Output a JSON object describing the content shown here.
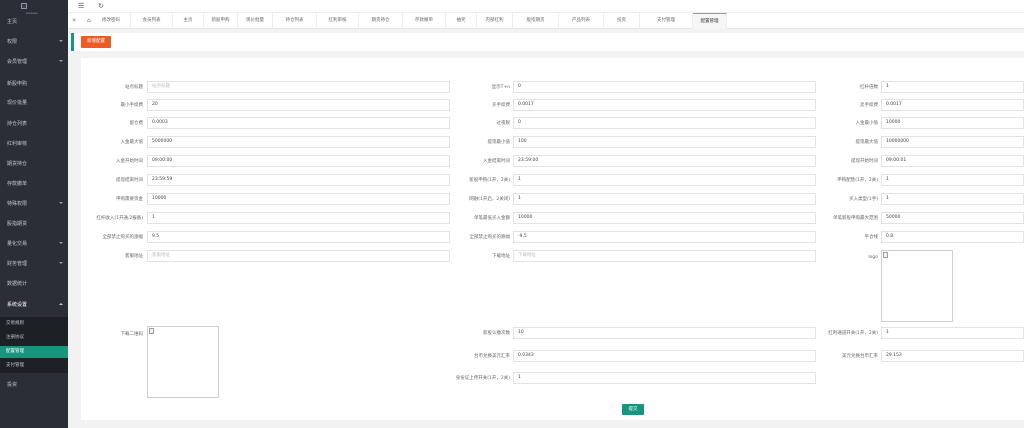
{
  "logo": {
    "sub": "Release"
  },
  "sidebar": {
    "items": [
      {
        "label": "主页",
        "arrow": "none"
      },
      {
        "label": "权限",
        "arrow": "down"
      },
      {
        "label": "会员管理",
        "arrow": "down"
      },
      {
        "label": "新股申购",
        "arrow": "none"
      },
      {
        "label": "现价批量",
        "arrow": "none"
      },
      {
        "label": "持仓列表",
        "arrow": "none"
      },
      {
        "label": "红利审核",
        "arrow": "none"
      },
      {
        "label": "期货持仓",
        "arrow": "none"
      },
      {
        "label": "存款撤单",
        "arrow": "none"
      },
      {
        "label": "特殊权限",
        "arrow": "down"
      },
      {
        "label": "股指期货",
        "arrow": "none"
      },
      {
        "label": "量化交易",
        "arrow": "down"
      },
      {
        "label": "财务管理",
        "arrow": "down"
      },
      {
        "label": "数据统计",
        "arrow": "none"
      },
      {
        "label": "系统设置",
        "arrow": "up"
      },
      {
        "label": "投资",
        "arrow": "none"
      }
    ],
    "sub_items": [
      {
        "label": "交易规则"
      },
      {
        "label": "注册协议"
      },
      {
        "label": "配置管理"
      },
      {
        "label": "支付管理"
      }
    ]
  },
  "topbar": {
    "menu_icon": "menu-icon",
    "refresh_icon": "refresh-icon"
  },
  "tabs": [
    "修改密码",
    "会员列表",
    "主页",
    "新股申购",
    "现价批量",
    "持仓列表",
    "红利审核",
    "期货持仓",
    "存款撤单",
    "抽奖",
    "内部红利",
    "股指期货",
    "产品列表",
    "投资",
    "支付管理",
    "配置管理"
  ],
  "toolbar": {
    "add_label": "新增配置"
  },
  "form": {
    "fields": [
      {
        "label": "站点标题",
        "value": "",
        "placeholder": "站点标题"
      },
      {
        "label": "显示T+n",
        "value": "0",
        "placeholder": ""
      },
      {
        "label": "红杆倍数",
        "value": "1",
        "placeholder": ""
      },
      {
        "label": "最小手续费",
        "value": "20",
        "placeholder": ""
      },
      {
        "label": "买手续费",
        "value": "0.0017",
        "placeholder": ""
      },
      {
        "label": "卖手续费",
        "value": "0.0017",
        "placeholder": ""
      },
      {
        "label": "留仓费",
        "value": "0.0003",
        "placeholder": ""
      },
      {
        "label": "过夜税",
        "value": "0",
        "placeholder": ""
      },
      {
        "label": "入金最小值",
        "value": "10000",
        "placeholder": ""
      },
      {
        "label": "入金最大值",
        "value": "5000000",
        "placeholder": ""
      },
      {
        "label": "提现最小值",
        "value": "100",
        "placeholder": ""
      },
      {
        "label": "提现最大值",
        "value": "10000000",
        "placeholder": ""
      },
      {
        "label": "入金开始时间",
        "value": "09:00:00",
        "placeholder": ""
      },
      {
        "label": "入金结束时间",
        "value": "23:59:00",
        "placeholder": ""
      },
      {
        "label": "提现开始时间",
        "value": "09:00:01",
        "placeholder": ""
      },
      {
        "label": "提现结束时间",
        "value": "23:59:59",
        "placeholder": ""
      },
      {
        "label": "新股申购(1开，2关)",
        "value": "1",
        "placeholder": ""
      },
      {
        "label": "申购配售(1开，2关)",
        "value": "1",
        "placeholder": ""
      },
      {
        "label": "申购需要资金",
        "value": "10000",
        "placeholder": ""
      },
      {
        "label": "网融(1开启，2关闭)",
        "value": "1",
        "placeholder": ""
      },
      {
        "label": "买入类型(1手)",
        "value": "1",
        "placeholder": ""
      },
      {
        "label": "红杆收入(1开通,2报备)",
        "value": "1",
        "placeholder": ""
      },
      {
        "label": "单笔最低买入金额",
        "value": "10000",
        "placeholder": ""
      },
      {
        "label": "单笔新股申购最大范围",
        "value": "50000",
        "placeholder": ""
      },
      {
        "label": "全部禁止购买的涨幅",
        "value": "9.5",
        "placeholder": ""
      },
      {
        "label": "全部禁止购买的跌幅",
        "value": "-9.5",
        "placeholder": ""
      },
      {
        "label": "平仓线",
        "value": "0.8",
        "placeholder": ""
      },
      {
        "label": "客服地址",
        "value": "",
        "placeholder": "客服地址"
      },
      {
        "label": "下载地址",
        "value": "",
        "placeholder": "下载地址"
      },
      {
        "label": "新股认缴次数",
        "value": "10",
        "placeholder": ""
      },
      {
        "label": "红利通道开关(1开，2关)",
        "value": "1",
        "placeholder": ""
      },
      {
        "label": "台币兑换美元汇率",
        "value": "0.0343",
        "placeholder": ""
      },
      {
        "label": "美元兑换台币汇率",
        "value": "29.153",
        "placeholder": ""
      },
      {
        "label": "身份证上传开关(1开，2关)",
        "value": "1",
        "placeholder": ""
      }
    ],
    "logo_label": "logo",
    "qr_label": "下载二维码",
    "submit_label": "提交"
  }
}
